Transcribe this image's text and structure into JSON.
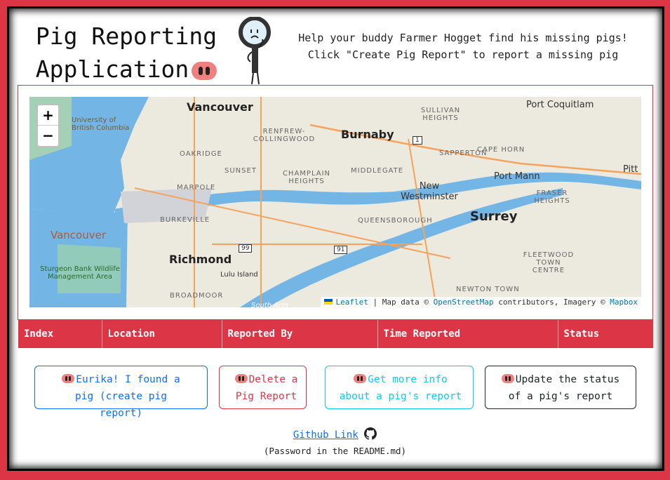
{
  "header": {
    "title_line1": "Pig Reporting",
    "title_line2": "Application",
    "intro": "Help your buddy Farmer Hogget find his missing pigs! Click \"Create Pig Report\" to report a missing pig"
  },
  "map": {
    "zoom_in": "+",
    "zoom_out": "−",
    "labels": {
      "vancouver": "Vancouver",
      "burnaby": "Burnaby",
      "surrey": "Surrey",
      "richmond": "Richmond",
      "new_westminster": "New Westminster",
      "port_coquitlam": "Port Coquitlam",
      "port_mann": "Port Mann",
      "pitt": "Pitt",
      "ubc": "University of British Columbia",
      "oakridge": "OAKRIDGE",
      "renfrew": "RENFREW- COLLINGWOOD",
      "sunset": "SUNSET",
      "champlain": "CHAMPLAIN HEIGHTS",
      "middlegate": "MIDDLEGATE",
      "sullivan": "SULLIVAN HEIGHTS",
      "sapperton": "SAPPERTON",
      "cape_horn": "CAPE HORN",
      "marpole": "MARPOLE",
      "burkeville": "BURKEVILLE",
      "queensborough": "QUEENSBOROUGH",
      "fraser_heights": "FRASER HEIGHTS",
      "fleetwood": "FLEETWOOD TOWN CENTRE",
      "newton": "NEWTON TOWN",
      "broadmoor": "BROADMOOR",
      "lulu": "Lulu Island",
      "vancouver_water": "Vancouver",
      "sturgeon": "Sturgeon Bank Wildlife Management Area",
      "south_arm": "South Arm",
      "hwy1": "1",
      "hwy99": "99",
      "hwy91": "91"
    },
    "attribution": {
      "leaflet": "Leaflet",
      "sep": "| Map data ©",
      "osm": "OpenStreetMap",
      "contrib": "contributors, Imagery ©",
      "mapbox": "Mapbox"
    }
  },
  "table": {
    "headers": [
      "Index",
      "Location",
      "Reported By",
      "Time Reported",
      "Status"
    ]
  },
  "buttons": [
    {
      "label": "Eurika! I found a pig (create pig report)",
      "color": "#0d6efd"
    },
    {
      "label": "Delete a Pig Report",
      "color": "#dc3545"
    },
    {
      "label": "Get more info about a pig's report",
      "color": "#0dcaf0"
    },
    {
      "label": "Update the status of a pig's report",
      "color": "#212529"
    }
  ],
  "footer": {
    "github": "Github Link",
    "password_note": "(Password in the README.md)"
  }
}
